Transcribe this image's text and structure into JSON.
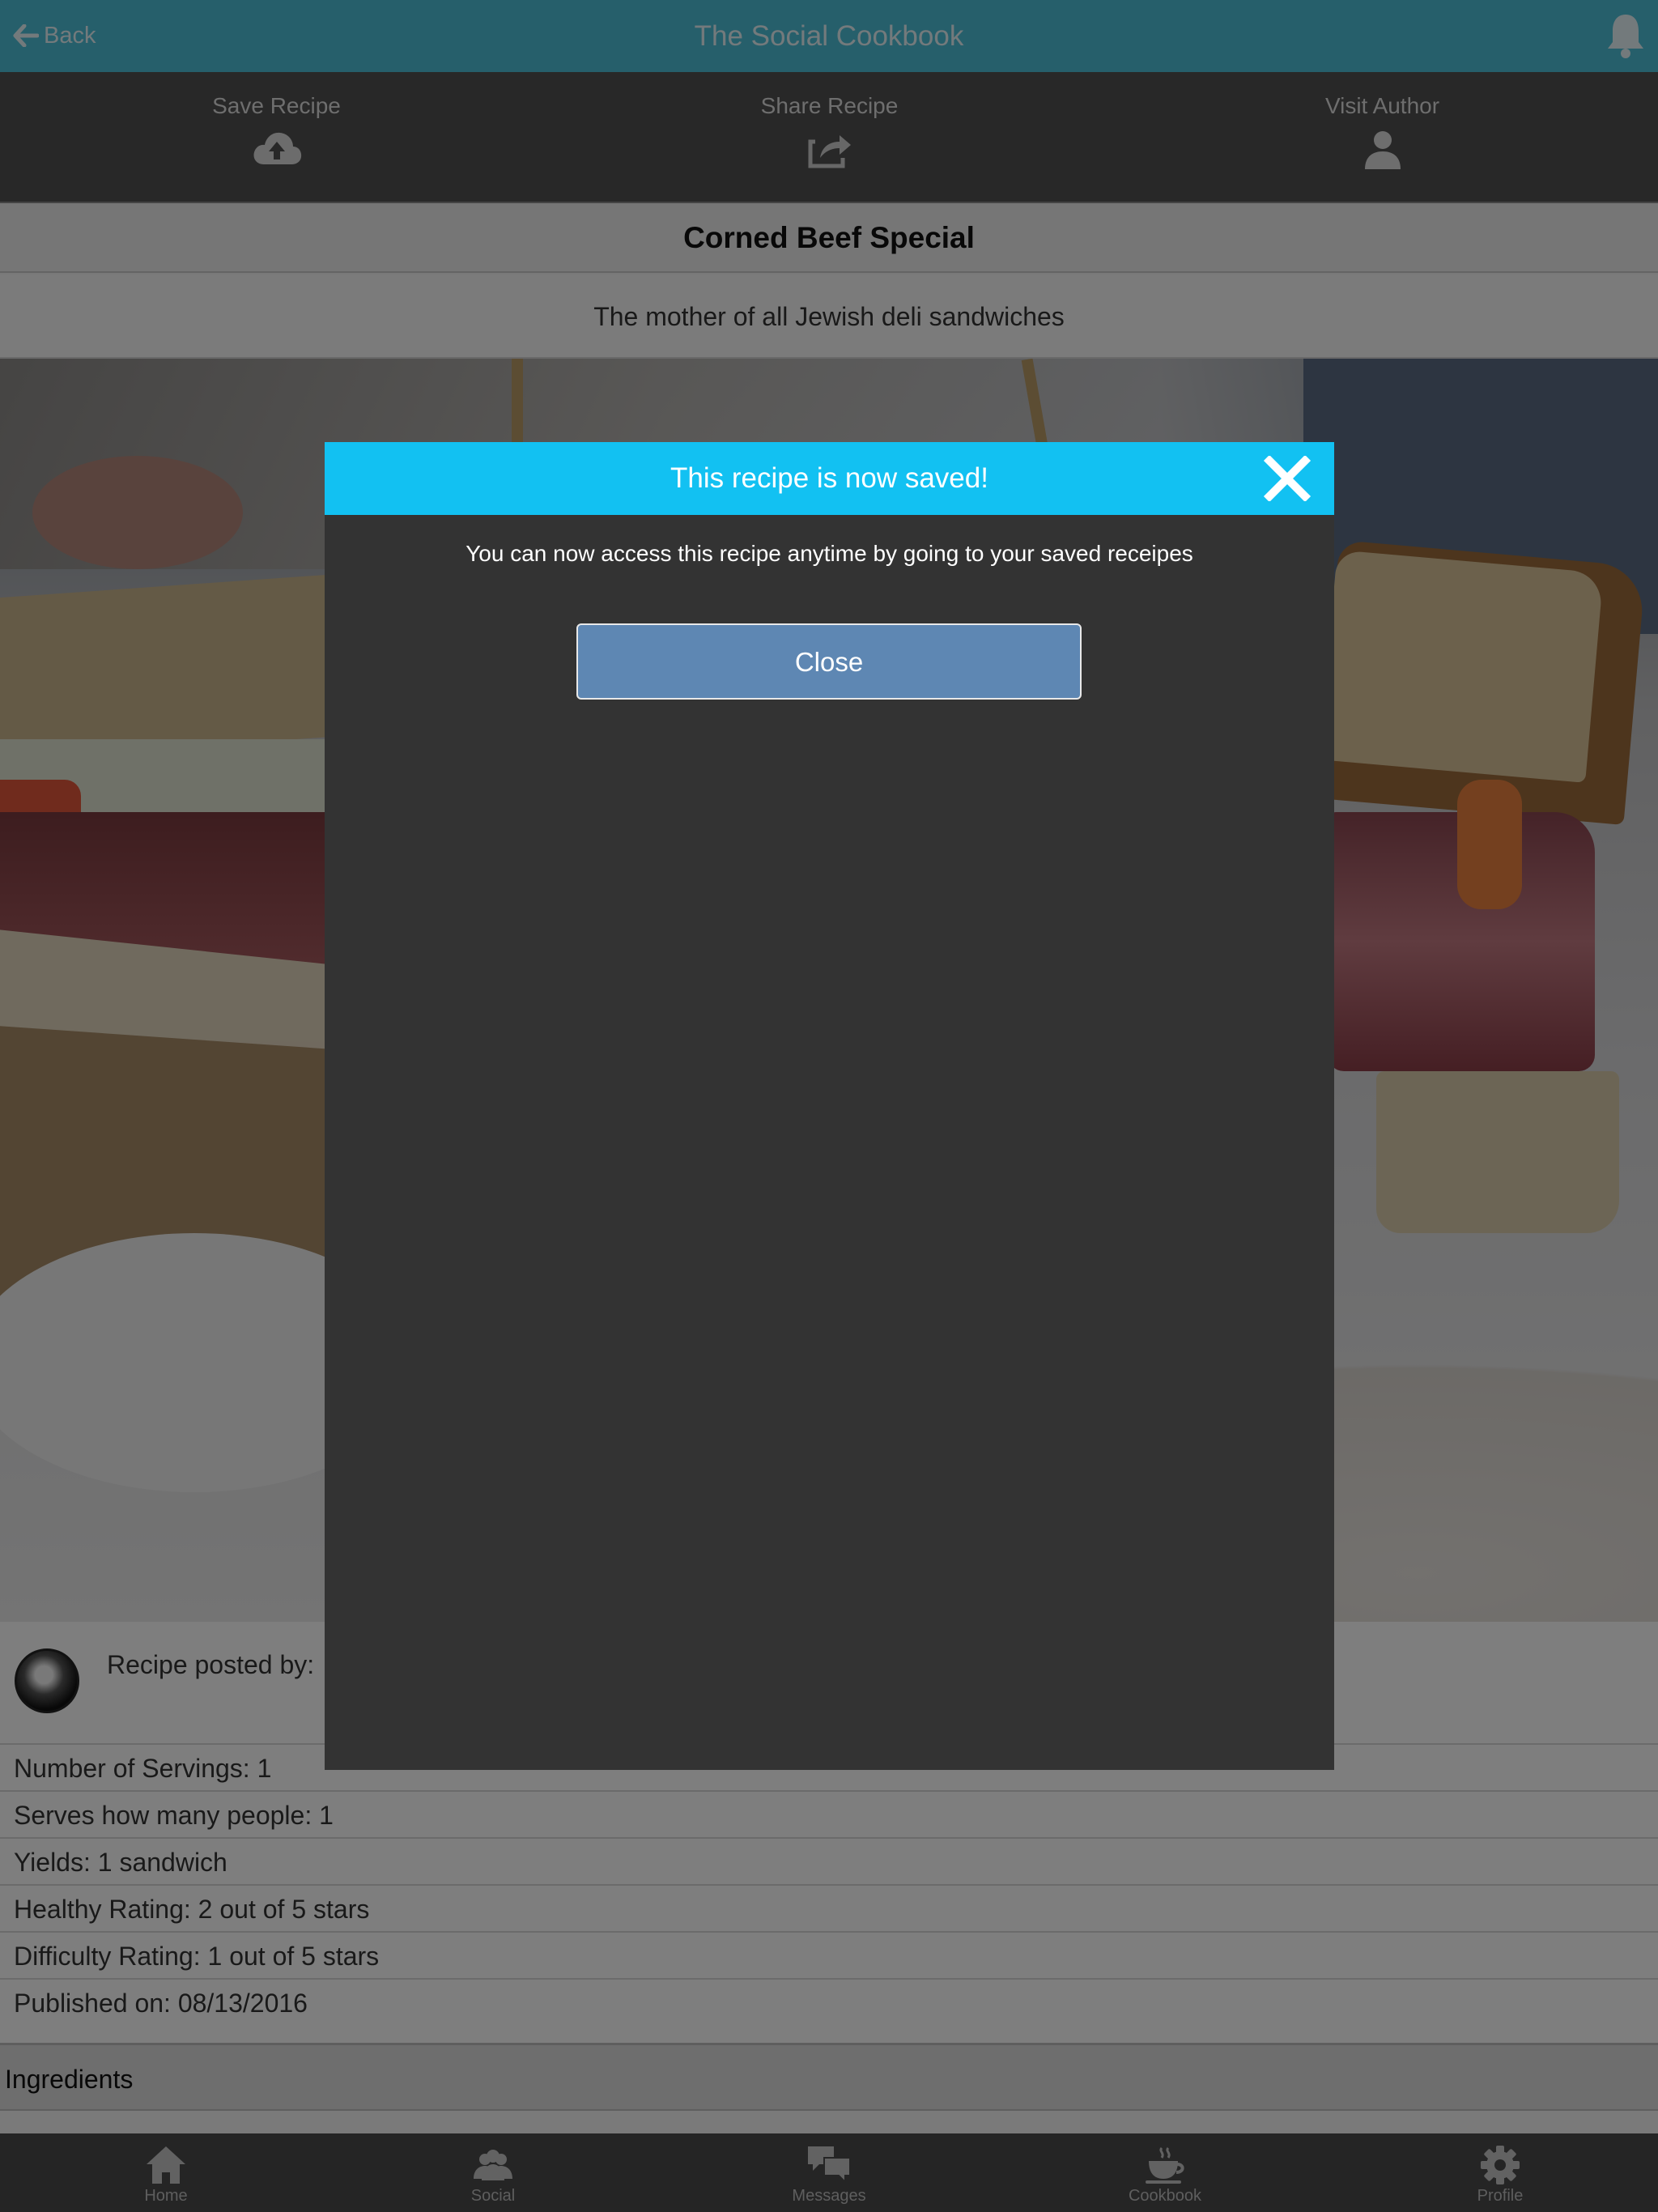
{
  "header": {
    "back_label": "Back",
    "title": "The Social Cookbook"
  },
  "actions": {
    "save": "Save Recipe",
    "share": "Share Recipe",
    "visit": "Visit Author"
  },
  "recipe": {
    "title": "Corned Beef Special",
    "subtitle": "The mother of all Jewish deli sandwiches",
    "posted_by_label": "Recipe posted by:",
    "details": [
      "Number of Servings: 1",
      "Serves how many people: 1",
      "Yields: 1 sandwich",
      "Healthy Rating: 2 out of 5 stars",
      "Difficulty Rating: 1 out of 5 stars",
      "Published on: 08/13/2016"
    ],
    "ingredients_label": "Ingredients"
  },
  "modal": {
    "title": "This recipe is now saved!",
    "message": "You can now access this recipe anytime by going to your saved receipes",
    "close_button": "Close"
  },
  "tabbar": {
    "items": [
      {
        "label": "Home",
        "icon": "home-icon"
      },
      {
        "label": "Social",
        "icon": "people-icon"
      },
      {
        "label": "Messages",
        "icon": "chat-bubbles-icon"
      },
      {
        "label": "Cookbook",
        "icon": "coffee-cup-icon"
      },
      {
        "label": "Profile",
        "icon": "gear-icon"
      }
    ]
  },
  "colors": {
    "header_bg": "#4dbed6",
    "modal_header": "#12c1f2",
    "modal_bg": "#333333",
    "close_button": "#5e87b3",
    "tabbar_bg": "#4b4b4b"
  }
}
